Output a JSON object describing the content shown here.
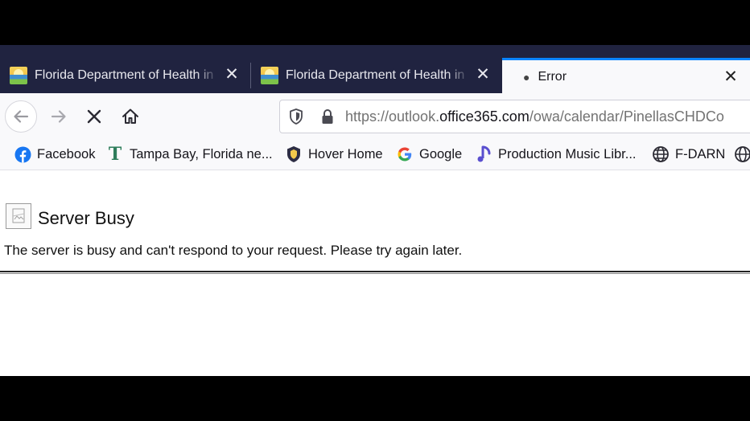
{
  "tabs": [
    {
      "title": "Florida Department of Health in Pinellas",
      "icon": "florida-doh-favicon",
      "active": false
    },
    {
      "title": "Florida Department of Health in Pinellas",
      "icon": "florida-doh-favicon",
      "active": false
    },
    {
      "title": "Error",
      "active": true
    }
  ],
  "address": {
    "prefix": "https://outlook.",
    "host": "office365.com",
    "path": "/owa/calendar/PinellasCHDCo"
  },
  "bookmarks": [
    {
      "label": "Facebook",
      "icon": "facebook-icon"
    },
    {
      "label": "Tampa Bay, Florida ne...",
      "icon": "tampa-bay-times-icon"
    },
    {
      "label": "Hover Home",
      "icon": "hover-icon"
    },
    {
      "label": "Google",
      "icon": "google-icon"
    },
    {
      "label": "Production Music Libr...",
      "icon": "music-note-icon"
    },
    {
      "label": "F-DARN",
      "icon": "globe-icon"
    }
  ],
  "page": {
    "heading": "Server Busy",
    "message": "The server is busy and can't respond to your request. Please try again later."
  },
  "colors": {
    "tabstrip": "#202340",
    "active_tab_accent": "#0a84ff",
    "toolbar": "#f9f9fb"
  }
}
